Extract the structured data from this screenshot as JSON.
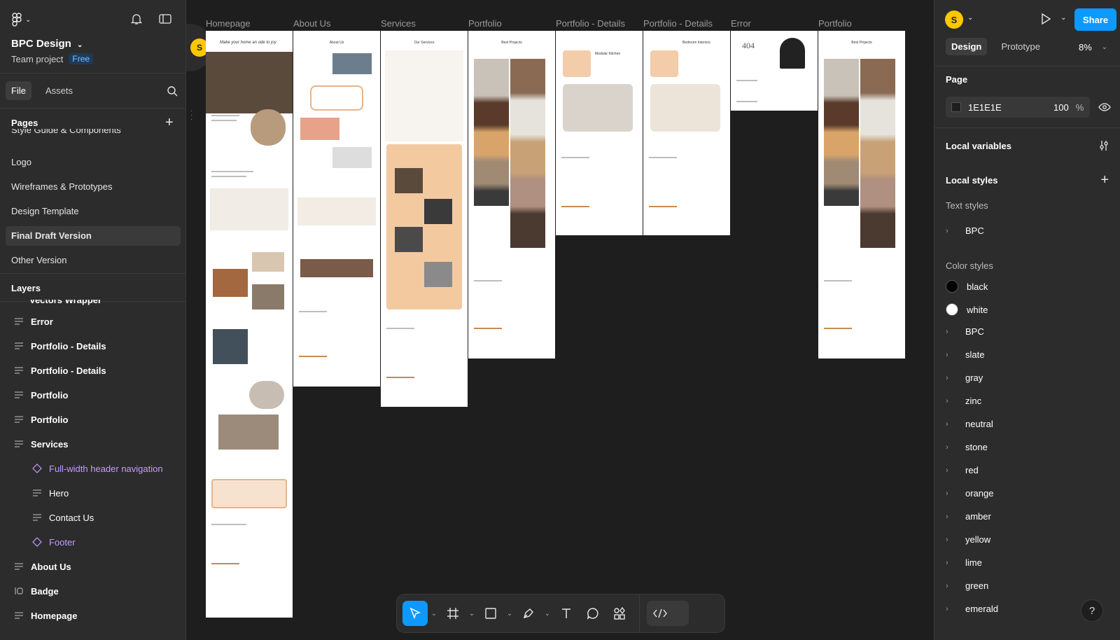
{
  "app": {
    "title": "BPC Design",
    "team": "Team project",
    "plan": "Free"
  },
  "left": {
    "tabs": [
      "File",
      "Assets"
    ],
    "pages_title": "Pages",
    "pages_partial": "Style Guide & Components",
    "pages": [
      "Logo",
      "Wireframes & Prototypes",
      "Design Template",
      "Final Draft Version",
      "Other Version"
    ],
    "selected_page": "Final Draft Version",
    "layers_title": "Layers",
    "layers_partial": "Vectors Wrapper",
    "layers": [
      {
        "label": "Error",
        "type": "frame"
      },
      {
        "label": "Portfolio - Details",
        "type": "frame"
      },
      {
        "label": "Portfolio - Details",
        "type": "frame"
      },
      {
        "label": "Portfolio",
        "type": "frame"
      },
      {
        "label": "Portfolio",
        "type": "frame"
      },
      {
        "label": "Services",
        "type": "frame"
      },
      {
        "label": "Full-width header navigation",
        "type": "instance"
      },
      {
        "label": "Hero",
        "type": "frame-child"
      },
      {
        "label": "Contact Us",
        "type": "frame-child"
      },
      {
        "label": "Footer",
        "type": "instance"
      },
      {
        "label": "About Us",
        "type": "frame"
      },
      {
        "label": "Badge",
        "type": "component"
      },
      {
        "label": "Homepage",
        "type": "frame"
      }
    ]
  },
  "canvas": {
    "frames": [
      "Homepage",
      "About Us",
      "Services",
      "Portfolio",
      "Portfolio - Details",
      "Portfolio - Details",
      "Error",
      "Portfolio"
    ],
    "frame_headings": {
      "homepage": "Make your home an ode to joy",
      "about": "About Us",
      "services": "Our Services",
      "portfolio": "Best Projects",
      "details1": "Modular Kitchen",
      "details2": "Bedroom Interiors",
      "error": "404",
      "portfolio2": "Best Projects"
    },
    "cursor_avatar": "S"
  },
  "right": {
    "user_initial": "S",
    "share_label": "Share",
    "tabs": [
      "Design",
      "Prototype"
    ],
    "zoom": "8%",
    "page_title": "Page",
    "page_fill_hex": "1E1E1E",
    "page_fill_opacity": "100",
    "page_fill_unit": "%",
    "local_variables": "Local variables",
    "local_styles": "Local styles",
    "text_styles_title": "Text styles",
    "text_styles": [
      "BPC"
    ],
    "color_styles_title": "Color styles",
    "color_swatches": [
      {
        "label": "black",
        "color": "#000000"
      },
      {
        "label": "white",
        "color": "#ffffff"
      }
    ],
    "color_groups": [
      "BPC",
      "slate",
      "gray",
      "zinc",
      "neutral",
      "stone",
      "red",
      "orange",
      "amber",
      "yellow",
      "lime",
      "green",
      "emerald"
    ]
  },
  "toolbar": {
    "help": "?"
  }
}
